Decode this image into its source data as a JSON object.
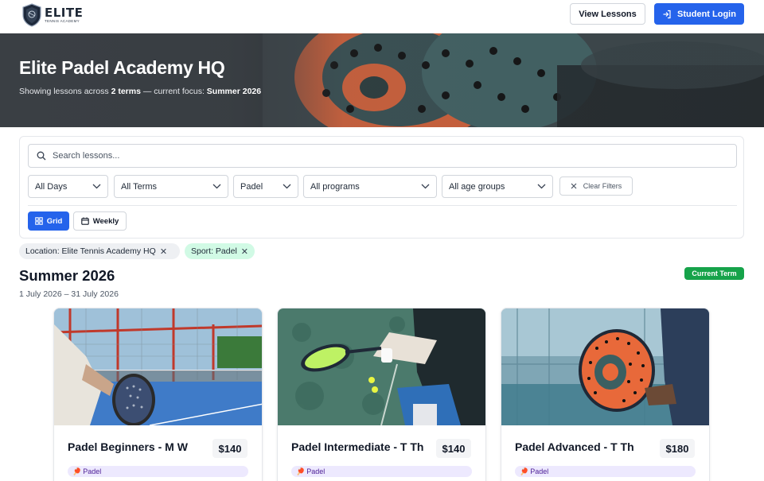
{
  "header": {
    "logo_text": "ELITE",
    "logo_subtext": "TENNIS ACADEMY",
    "view_lessons_label": "View Lessons",
    "student_login_label": "Student Login"
  },
  "hero": {
    "title": "Elite Padel Academy HQ",
    "subtitle_prefix": "Showing lessons across",
    "term_count": "2 terms",
    "subtitle_mid": "— current focus:",
    "focus": "Summer 2026"
  },
  "filters": {
    "search_placeholder": "Search lessons...",
    "selects": [
      {
        "value": "All Days"
      },
      {
        "value": "All Terms"
      },
      {
        "value": "Padel"
      },
      {
        "value": "All programs"
      },
      {
        "value": "All age groups"
      }
    ],
    "clear_label": "Clear Filters",
    "view_grid_label": "Grid",
    "view_weekly_label": "Weekly",
    "active_view": "Grid"
  },
  "chips": [
    {
      "label": "Location: Elite Tennis Academy HQ"
    },
    {
      "label": "Sport: Padel"
    }
  ],
  "term": {
    "title": "Summer 2026",
    "dates": "1 July 2026 – 31 July 2026",
    "badge": "Current Term"
  },
  "cards": [
    {
      "name": "Padel Beginners - M W",
      "price": "$140",
      "tag": "Padel"
    },
    {
      "name": "Padel Intermediate - T Th",
      "price": "$140",
      "tag": "Padel"
    },
    {
      "name": "Padel Advanced - T Th",
      "price": "$180",
      "tag": "Padel"
    }
  ],
  "colors": {
    "primary": "#2563eb",
    "success": "#16a34a",
    "sport_chip": "#d1fae5",
    "tag_bg": "#ede9fe"
  },
  "icons": [
    "shield-logo-icon",
    "login-icon",
    "search-icon",
    "chevron-down-icon",
    "close-icon",
    "grid-icon",
    "calendar-icon",
    "racket-icon"
  ]
}
